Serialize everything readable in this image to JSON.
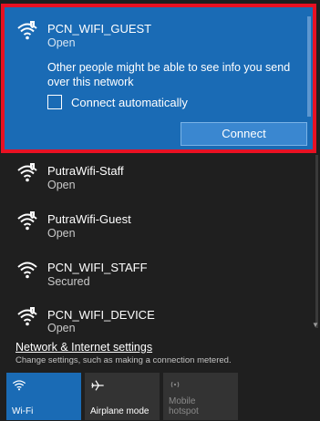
{
  "selected_network": {
    "name": "PCN_WIFI_GUEST",
    "status": "Open",
    "warning": "Other people might be able to see info you send over this network",
    "auto_connect_label": "Connect automatically",
    "connect_label": "Connect"
  },
  "networks": [
    {
      "name": "PutraWifi-Staff",
      "status": "Open",
      "icon": "wifi-open-icon"
    },
    {
      "name": "PutraWifi-Guest",
      "status": "Open",
      "icon": "wifi-open-icon"
    },
    {
      "name": "PCN_WIFI_STAFF",
      "status": "Secured",
      "icon": "wifi-secured-icon"
    },
    {
      "name": "PCN_WIFI_DEVICE",
      "status": "Open",
      "icon": "wifi-open-icon"
    }
  ],
  "settings": {
    "link": "Network & Internet settings",
    "desc": "Change settings, such as making a connection metered."
  },
  "quick_actions": [
    {
      "label": "Wi-Fi",
      "icon": "wifi-icon"
    },
    {
      "label": "Airplane mode",
      "icon": "airplane-icon"
    },
    {
      "label": "Mobile\nhotspot",
      "icon": "hotspot-icon"
    }
  ],
  "colors": {
    "accent": "#1a6bb5",
    "highlight": "#e81123",
    "panel": "#1f1f1f"
  }
}
